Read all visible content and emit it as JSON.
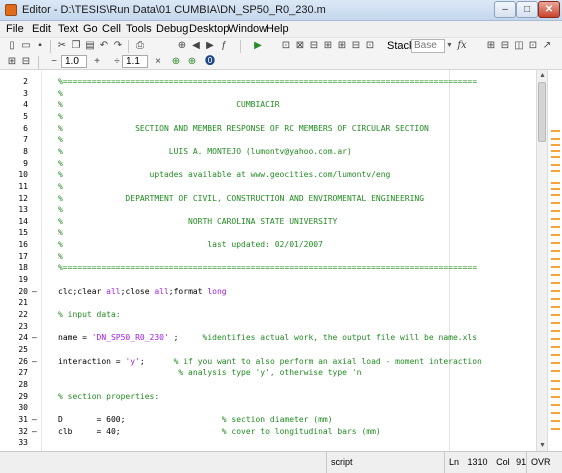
{
  "window": {
    "title": "Editor - D:\\TESIS\\Run Data\\01 CUMBIA\\DN_SP50_R0_230.m"
  },
  "menu": [
    "File",
    "Edit",
    "Text",
    "Go",
    "Cell",
    "Tools",
    "Debug",
    "Desktop",
    "Window",
    "Help"
  ],
  "toolbar": {
    "stack_label": "Stack:",
    "stack_value": "Base",
    "fx_label": "fx"
  },
  "cellbar": {
    "minus": "−",
    "value1": "1.0",
    "plus": "+",
    "divide": "÷",
    "value2": "1.1",
    "times": "×"
  },
  "editor": {
    "lines": [
      {
        "n": "2",
        "dash": "",
        "segs": [
          {
            "t": "%======================================================================================",
            "k": "c"
          }
        ]
      },
      {
        "n": "3",
        "dash": "",
        "segs": [
          {
            "t": "%",
            "k": "c"
          }
        ]
      },
      {
        "n": "4",
        "dash": "",
        "segs": [
          {
            "t": "%                                    CUMBIACIR",
            "k": "c"
          }
        ]
      },
      {
        "n": "5",
        "dash": "",
        "segs": [
          {
            "t": "%",
            "k": "c"
          }
        ]
      },
      {
        "n": "6",
        "dash": "",
        "segs": [
          {
            "t": "%               SECTION AND MEMBER RESPONSE OF RC MEMBERS OF CIRCULAR SECTION",
            "k": "c"
          }
        ]
      },
      {
        "n": "7",
        "dash": "",
        "segs": [
          {
            "t": "%",
            "k": "c"
          }
        ]
      },
      {
        "n": "8",
        "dash": "",
        "segs": [
          {
            "t": "%                      LUIS A. MONTEJO (lumontv@yahoo.com.ar)",
            "k": "c"
          }
        ]
      },
      {
        "n": "9",
        "dash": "",
        "segs": [
          {
            "t": "%",
            "k": "c"
          }
        ]
      },
      {
        "n": "10",
        "dash": "",
        "segs": [
          {
            "t": "%                  uptades available at www.geocities.com/lumontv/eng",
            "k": "c"
          }
        ]
      },
      {
        "n": "11",
        "dash": "",
        "segs": [
          {
            "t": "%",
            "k": "c"
          }
        ]
      },
      {
        "n": "12",
        "dash": "",
        "segs": [
          {
            "t": "%             DEPARTMENT OF CIVIL, CONSTRUCTION AND ENVIROMENTAL ENGINEERING",
            "k": "c"
          }
        ]
      },
      {
        "n": "13",
        "dash": "",
        "segs": [
          {
            "t": "%",
            "k": "c"
          }
        ]
      },
      {
        "n": "14",
        "dash": "",
        "segs": [
          {
            "t": "%                          NORTH CAROLINA STATE UNIVERSITY",
            "k": "c"
          }
        ]
      },
      {
        "n": "15",
        "dash": "",
        "segs": [
          {
            "t": "%",
            "k": "c"
          }
        ]
      },
      {
        "n": "16",
        "dash": "",
        "segs": [
          {
            "t": "%                              last updated: 02/01/2007",
            "k": "c"
          }
        ]
      },
      {
        "n": "17",
        "dash": "",
        "segs": [
          {
            "t": "%",
            "k": "c"
          }
        ]
      },
      {
        "n": "18",
        "dash": "",
        "segs": [
          {
            "t": "%======================================================================================",
            "k": "c"
          }
        ]
      },
      {
        "n": "19",
        "dash": "",
        "segs": [
          {
            "t": "",
            "k": ""
          }
        ]
      },
      {
        "n": "20",
        "dash": "–",
        "segs": [
          {
            "t": "clc;clear ",
            "k": ""
          },
          {
            "t": "all",
            "k": "s"
          },
          {
            "t": ";close ",
            "k": ""
          },
          {
            "t": "all",
            "k": "s"
          },
          {
            "t": ";format ",
            "k": ""
          },
          {
            "t": "long",
            "k": "s"
          }
        ]
      },
      {
        "n": "21",
        "dash": "",
        "segs": [
          {
            "t": "",
            "k": ""
          }
        ]
      },
      {
        "n": "22",
        "dash": "",
        "segs": [
          {
            "t": "% input data:",
            "k": "c"
          }
        ]
      },
      {
        "n": "23",
        "dash": "",
        "segs": [
          {
            "t": "",
            "k": ""
          }
        ]
      },
      {
        "n": "24",
        "dash": "–",
        "segs": [
          {
            "t": "name = ",
            "k": ""
          },
          {
            "t": "'DN_SP50_R0_230'",
            "k": "s"
          },
          {
            "t": " ;     ",
            "k": ""
          },
          {
            "t": "%identifies actual work, the output file will be name.xls",
            "k": "c"
          }
        ]
      },
      {
        "n": "25",
        "dash": "",
        "segs": [
          {
            "t": "",
            "k": ""
          }
        ]
      },
      {
        "n": "26",
        "dash": "–",
        "segs": [
          {
            "t": "interaction = ",
            "k": ""
          },
          {
            "t": "'y'",
            "k": "s"
          },
          {
            "t": ";      ",
            "k": ""
          },
          {
            "t": "% if you want to also perform an axial load - moment interaction",
            "k": "c"
          }
        ]
      },
      {
        "n": "27",
        "dash": "",
        "segs": [
          {
            "t": "                         ",
            "k": ""
          },
          {
            "t": "% analysis type 'y', otherwise type 'n",
            "k": "c"
          }
        ]
      },
      {
        "n": "28",
        "dash": "",
        "segs": [
          {
            "t": "",
            "k": ""
          }
        ]
      },
      {
        "n": "29",
        "dash": "",
        "segs": [
          {
            "t": "% section properties:",
            "k": "c"
          }
        ]
      },
      {
        "n": "30",
        "dash": "",
        "segs": [
          {
            "t": "",
            "k": ""
          }
        ]
      },
      {
        "n": "31",
        "dash": "–",
        "segs": [
          {
            "t": "D       = 600;                    ",
            "k": ""
          },
          {
            "t": "% section diameter (mm)",
            "k": "c"
          }
        ]
      },
      {
        "n": "32",
        "dash": "–",
        "segs": [
          {
            "t": "clb     = 40;                     ",
            "k": ""
          },
          {
            "t": "% cover to longitudinal bars (mm)",
            "k": "c"
          }
        ]
      },
      {
        "n": "33",
        "dash": "",
        "segs": [
          {
            "t": "",
            "k": ""
          }
        ]
      }
    ]
  },
  "status": {
    "mode": "script",
    "ln_label": "Ln",
    "ln_value": "1310",
    "col_label": "Col",
    "col_value": "91",
    "ovr": "OVR"
  },
  "colors": {
    "comment": "#228b22",
    "string": "#a020f0",
    "marker": "#f7a23b"
  }
}
